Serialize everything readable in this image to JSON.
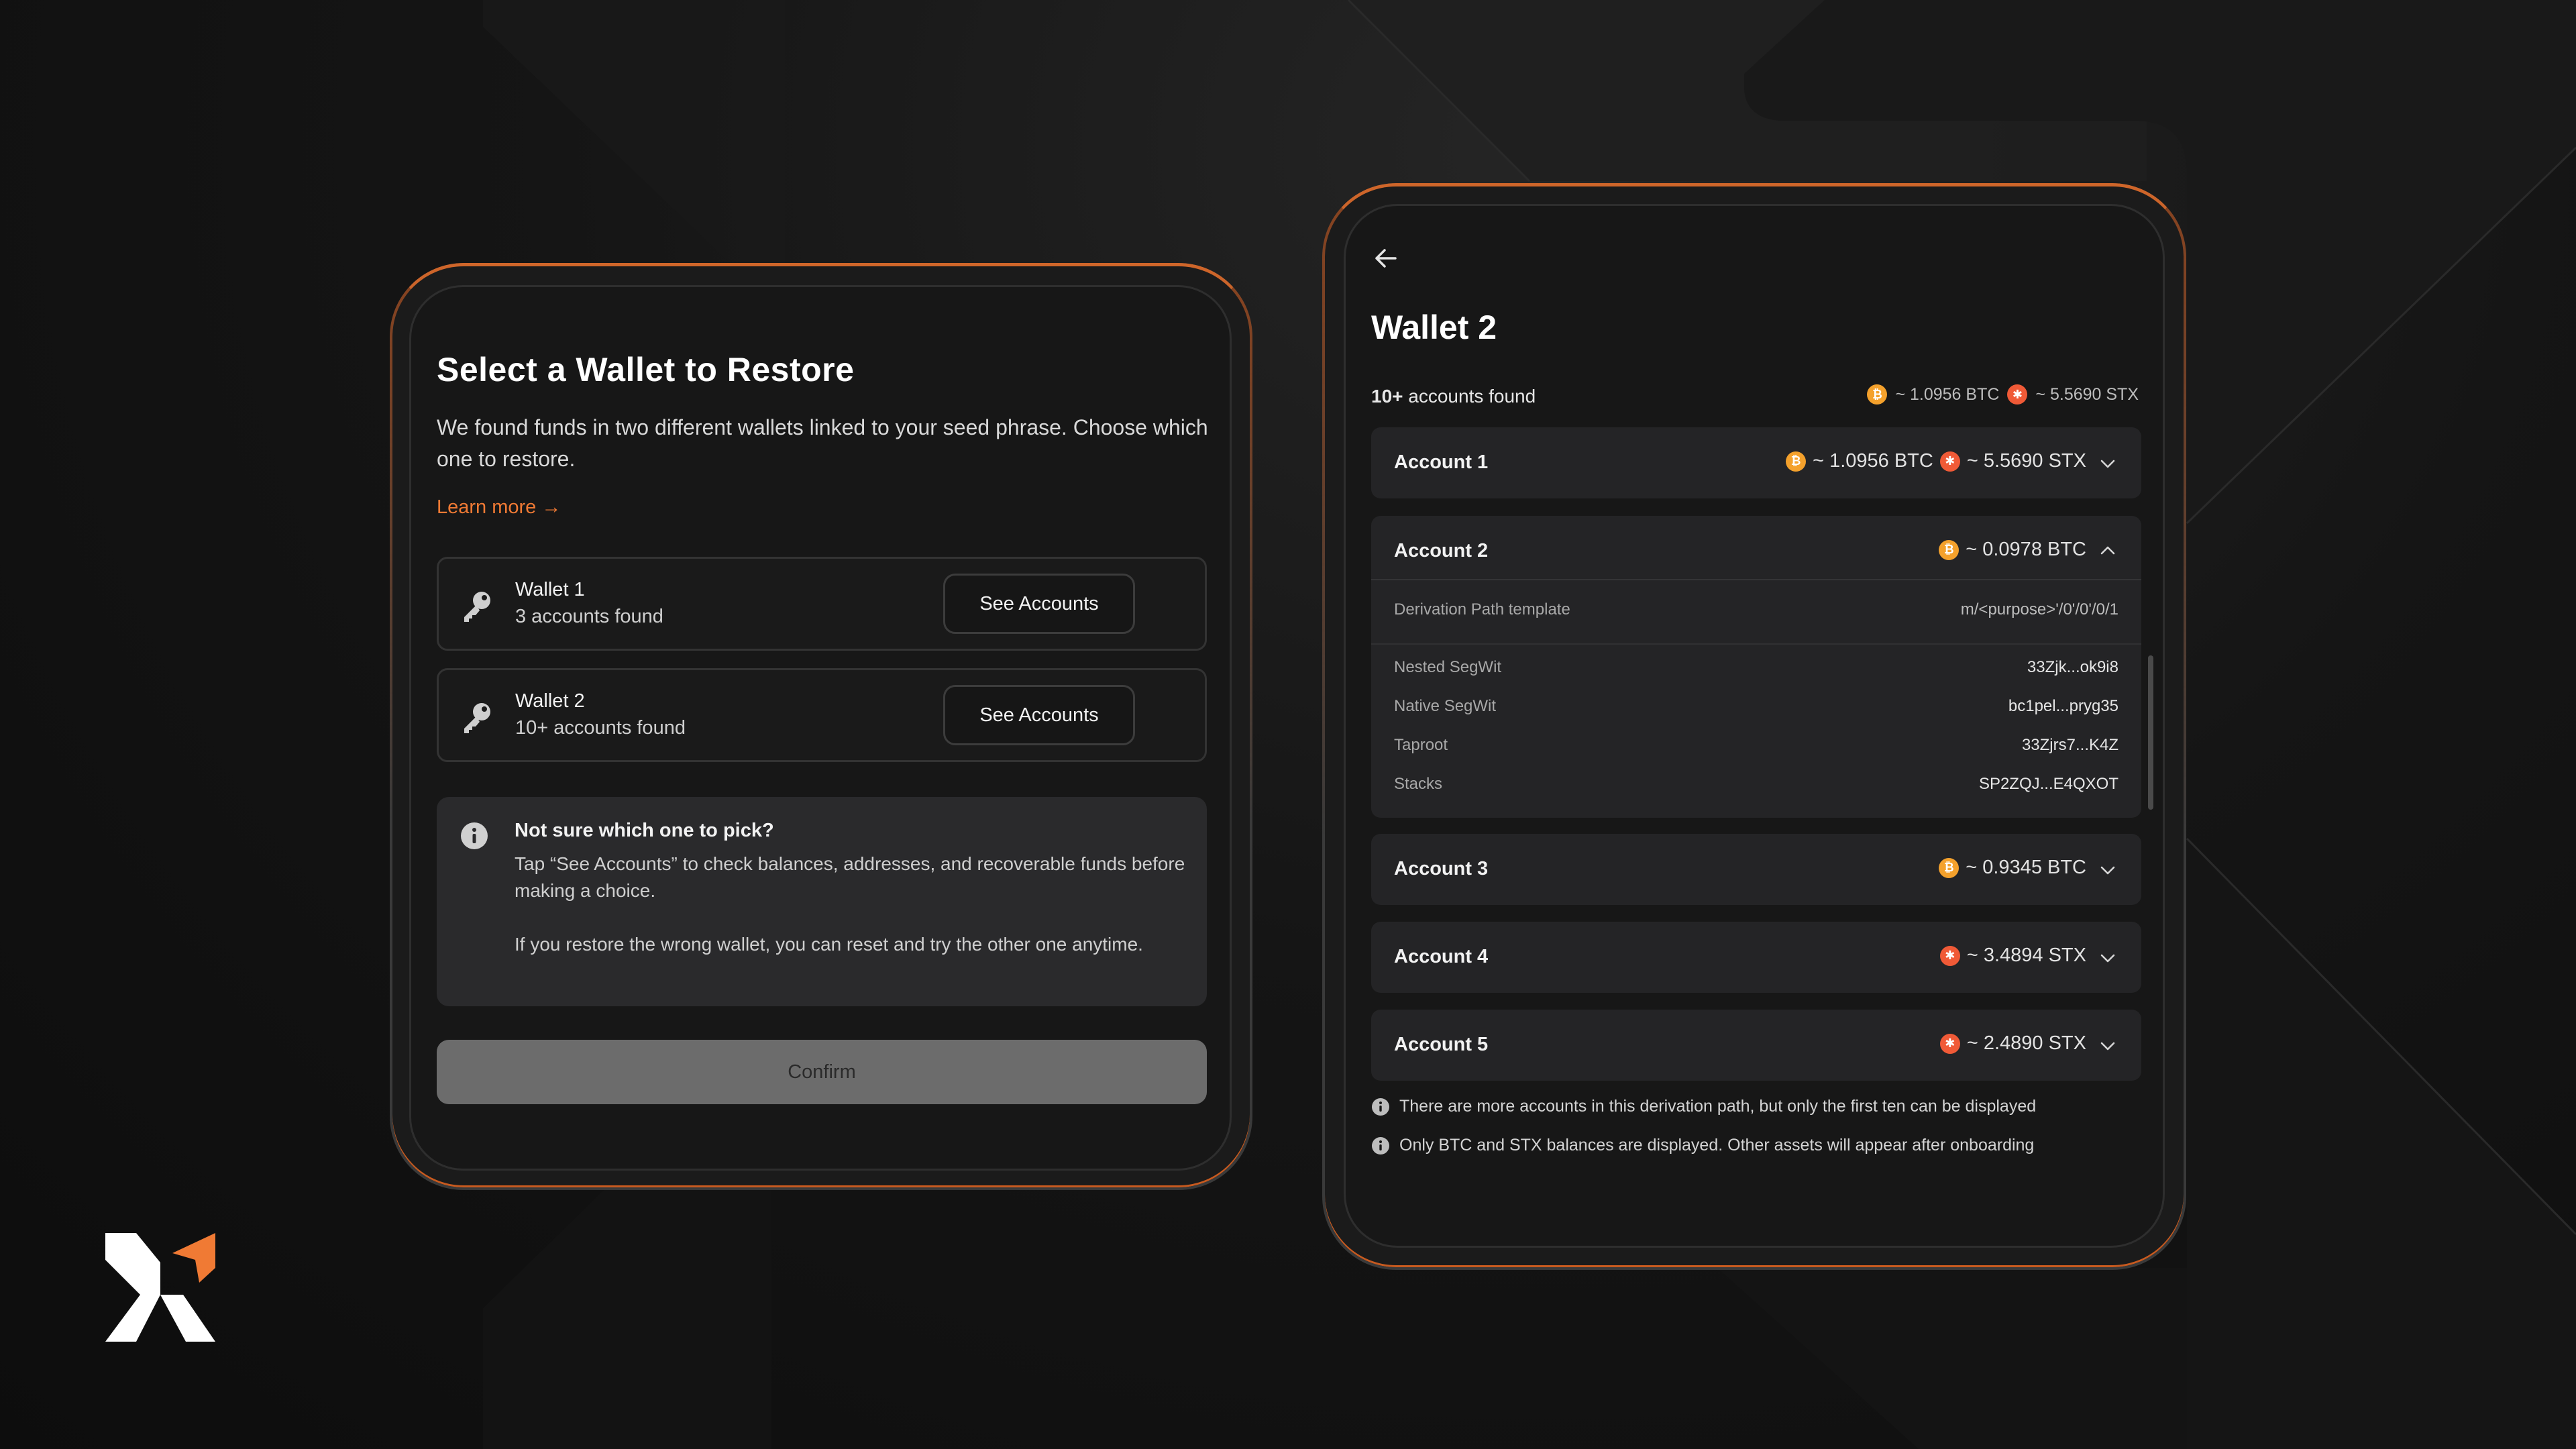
{
  "colors": {
    "accent": "#f07a34",
    "btc": "#f4a12c",
    "stx": "#f05a37",
    "background": "#0f0f0f",
    "card": "#171717"
  },
  "left": {
    "title": "Select a Wallet to Restore",
    "description": "We found funds in two different wallets linked to your seed phrase. Choose which one to restore.",
    "learn_more": "Learn more →",
    "wallets": [
      {
        "name": "Wallet 1",
        "subtitle": "3 accounts found",
        "button": "See Accounts",
        "icon": "key-icon"
      },
      {
        "name": "Wallet 2",
        "subtitle": "10+ accounts found",
        "button": "See Accounts",
        "icon": "key-icon"
      }
    ],
    "info": {
      "icon": "info-icon",
      "title": "Not sure which one to pick?",
      "p1": "Tap “See Accounts” to check balances, addresses, and recoverable funds before making a choice.",
      "p2": "If you restore the wrong wallet, you can reset and try the other one anytime."
    },
    "confirm": "Confirm"
  },
  "right": {
    "back_icon": "arrow-left-icon",
    "title": "Wallet 2",
    "found_count": "10+",
    "found_text": " accounts found",
    "total_btc": "~ 1.0956 BTC",
    "total_stx": "~ 5.5690 STX",
    "accounts": [
      {
        "name": "Account 1",
        "btc": "~ 1.0956 BTC",
        "stx": "~ 5.5690 STX"
      },
      {
        "name": "Account 2",
        "btc": "~ 0.0978 BTC"
      },
      {
        "name": "Account 3",
        "btc": "~ 0.9345 BTC"
      },
      {
        "name": "Account 4",
        "stx": "~ 3.4894 STX"
      },
      {
        "name": "Account 5",
        "stx": "~ 2.4890 STX"
      }
    ],
    "expanded": {
      "derivation_label": "Derivation Path template",
      "derivation_value": "m/<purpose>'/0'/0'/0/1",
      "addresses": [
        {
          "label": "Nested SegWit",
          "value": "33Zjk...ok9i8"
        },
        {
          "label": "Native SegWit",
          "value": "bc1pel...pryg35"
        },
        {
          "label": "Taproot",
          "value": "33Zjrs7...K4Z"
        },
        {
          "label": "Stacks",
          "value": "SP2ZQJ...E4QXOT"
        }
      ]
    },
    "notes": [
      "There are more accounts in this derivation path, but only the first ten can be displayed",
      "Only BTC and STX balances are displayed. Other assets will appear after onboarding"
    ]
  },
  "coin_icons": {
    "btc": "bitcoin-icon",
    "stx": "stacks-icon"
  },
  "logo": "xverse-logo"
}
